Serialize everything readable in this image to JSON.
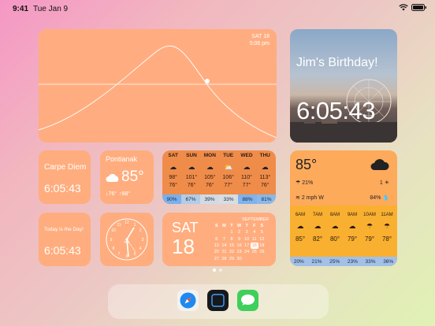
{
  "status": {
    "time": "9:41",
    "date": "Tue Jan 9"
  },
  "sun_widget": {
    "day": "SAT 18",
    "time": "5:06 pm"
  },
  "photo_widget": {
    "title": "Jim's Birthday!",
    "countdown": "6:05:43"
  },
  "carpe": {
    "label": "Carpe Diem",
    "time": "6:05:43"
  },
  "today": {
    "label": "Today is the Day!",
    "time": "6:05:43"
  },
  "weather_small": {
    "city": "Pontianak",
    "temp": "85°",
    "low": "↓76°",
    "high": "↑88°"
  },
  "forecast": {
    "days": [
      "SAT",
      "SUN",
      "MON",
      "TUE",
      "WED",
      "THU"
    ],
    "icons": [
      "rain",
      "rain",
      "rain",
      "partly-sunny",
      "rain",
      "rain"
    ],
    "highs": [
      "98°",
      "101°",
      "105°",
      "106°",
      "110°",
      "113°"
    ],
    "lows": [
      "76°",
      "76°",
      "76°",
      "77°",
      "77°",
      "76°"
    ],
    "precip": [
      "90%",
      "67%",
      "39%",
      "33%",
      "88%",
      "81%"
    ]
  },
  "calendar": {
    "dow": "SAT",
    "day": "18",
    "month": "SEPTEMBER",
    "headers": [
      "S",
      "M",
      "T",
      "W",
      "T",
      "F",
      "S"
    ],
    "weeks": [
      [
        "",
        "",
        "1",
        "2",
        "3",
        "4",
        "5"
      ],
      [
        "6",
        "7",
        "8",
        "9",
        "10",
        "11",
        "12"
      ],
      [
        "13",
        "14",
        "15",
        "16",
        "17",
        "18",
        "19"
      ],
      [
        "20",
        "21",
        "22",
        "23",
        "24",
        "25",
        "26"
      ],
      [
        "27",
        "28",
        "29",
        "30",
        "",
        "",
        ""
      ]
    ],
    "today": "18"
  },
  "big_weather": {
    "temp": "85°",
    "rain": "21%",
    "uv": "1",
    "wind": "2 mph W",
    "humidity": "84%",
    "hours": [
      "6AM",
      "7AM",
      "8AM",
      "9AM",
      "10AM",
      "11AM"
    ],
    "hour_temps": [
      "85°",
      "82°",
      "80°",
      "79°",
      "79°",
      "78°"
    ],
    "hour_precip": [
      "20%",
      "21%",
      "25%",
      "23%",
      "33%",
      "36%"
    ]
  },
  "dock": {
    "apps": [
      "safari",
      "frame",
      "messages"
    ]
  },
  "colors": {
    "accent": "#ffad7e",
    "forecast": "#f08c4a",
    "big": "#fdaa5b",
    "blue": "#a2c0e8"
  }
}
